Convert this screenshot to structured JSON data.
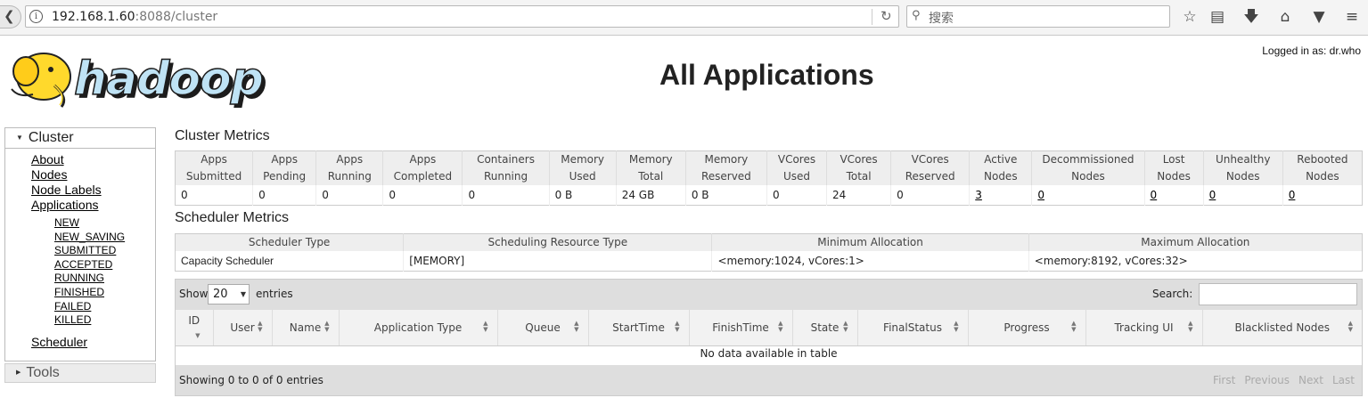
{
  "browser": {
    "url_host": "192.168.1.60",
    "url_path": ":8088/cluster",
    "search_placeholder": "搜索"
  },
  "header": {
    "logged_in": "Logged in as: dr.who",
    "title": "All Applications",
    "logo_text": "hadoop"
  },
  "sidebar": {
    "cluster_label": "Cluster",
    "links": [
      {
        "label": "About"
      },
      {
        "label": "Nodes"
      },
      {
        "label": "Node Labels"
      },
      {
        "label": "Applications"
      }
    ],
    "app_states": [
      "NEW",
      "NEW_SAVING",
      "SUBMITTED",
      "ACCEPTED",
      "RUNNING",
      "FINISHED",
      "FAILED",
      "KILLED"
    ],
    "scheduler_label": "Scheduler",
    "tools_label": "Tools"
  },
  "cluster_metrics": {
    "title": "Cluster Metrics",
    "headers": [
      [
        "Apps",
        "Submitted"
      ],
      [
        "Apps",
        "Pending"
      ],
      [
        "Apps",
        "Running"
      ],
      [
        "Apps",
        "Completed"
      ],
      [
        "Containers",
        "Running"
      ],
      [
        "Memory",
        "Used"
      ],
      [
        "Memory",
        "Total"
      ],
      [
        "Memory",
        "Reserved"
      ],
      [
        "VCores",
        "Used"
      ],
      [
        "VCores",
        "Total"
      ],
      [
        "VCores",
        "Reserved"
      ],
      [
        "Active",
        "Nodes"
      ],
      [
        "Decommissioned",
        "Nodes"
      ],
      [
        "Lost",
        "Nodes"
      ],
      [
        "Unhealthy",
        "Nodes"
      ],
      [
        "Rebooted",
        "Nodes"
      ]
    ],
    "values": [
      "0",
      "0",
      "0",
      "0",
      "0",
      "0 B",
      "24 GB",
      "0 B",
      "0",
      "24",
      "0",
      "3",
      "0",
      "0",
      "0",
      "0"
    ]
  },
  "scheduler_metrics": {
    "title": "Scheduler Metrics",
    "headers": [
      "Scheduler Type",
      "Scheduling Resource Type",
      "Minimum Allocation",
      "Maximum Allocation"
    ],
    "values": [
      "Capacity Scheduler",
      "[MEMORY]",
      "<memory:1024, vCores:1>",
      "<memory:8192, vCores:32>"
    ]
  },
  "applications": {
    "show_label": "Show",
    "page_length": "20",
    "entries_label": "entries",
    "search_label": "Search:",
    "columns": [
      "ID",
      "User",
      "Name",
      "Application Type",
      "Queue",
      "StartTime",
      "FinishTime",
      "State",
      "FinalStatus",
      "Progress",
      "Tracking UI",
      "Blacklisted Nodes"
    ],
    "empty_message": "No data available in table",
    "info": "Showing 0 to 0 of 0 entries",
    "pager": [
      "First",
      "Previous",
      "Next",
      "Last"
    ]
  }
}
